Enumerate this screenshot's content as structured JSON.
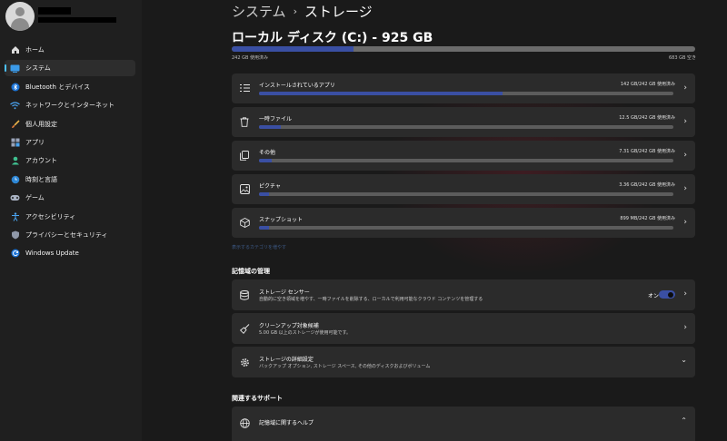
{
  "sidebar": {
    "items": [
      {
        "label": "ホーム",
        "icon": "home-icon"
      },
      {
        "label": "システム",
        "icon": "system-icon"
      },
      {
        "label": "Bluetooth とデバイス",
        "icon": "bluetooth-icon"
      },
      {
        "label": "ネットワークとインターネット",
        "icon": "wifi-icon"
      },
      {
        "label": "個人用設定",
        "icon": "brush-icon"
      },
      {
        "label": "アプリ",
        "icon": "apps-icon"
      },
      {
        "label": "アカウント",
        "icon": "account-icon"
      },
      {
        "label": "時刻と言語",
        "icon": "globe-clock-icon"
      },
      {
        "label": "ゲーム",
        "icon": "gamepad-icon"
      },
      {
        "label": "アクセシビリティ",
        "icon": "accessibility-icon"
      },
      {
        "label": "プライバシーとセキュリティ",
        "icon": "shield-icon"
      },
      {
        "label": "Windows Update",
        "icon": "update-icon"
      }
    ],
    "selected_index": 1
  },
  "header": {
    "parent": "システム",
    "separator": "›",
    "title": "ストレージ"
  },
  "drive": {
    "title": "ローカル ディスク (C:) - 925 GB",
    "used_text": "242 GB 使用済み",
    "free_text": "683 GB 空き",
    "used_fraction": 0.262
  },
  "categories": [
    {
      "label": "インストールされているアプリ",
      "value": "142 GB/242 GB 使用済み",
      "fraction": 0.587,
      "icon": "apps-list-icon"
    },
    {
      "label": "一時ファイル",
      "value": "12.5 GB/242 GB 使用済み",
      "fraction": 0.052,
      "icon": "trash-icon"
    },
    {
      "label": "その他",
      "value": "7.31 GB/242 GB 使用済み",
      "fraction": 0.03,
      "icon": "documents-icon"
    },
    {
      "label": "ピクチャ",
      "value": "3.36 GB/242 GB 使用済み",
      "fraction": 0.014,
      "icon": "picture-icon"
    },
    {
      "label": "スナップショット",
      "value": "899 MB/242 GB 使用済み",
      "fraction": 0.004,
      "icon": "snapshot-icon"
    }
  ],
  "more_categories_link": "表示するカテゴリを増やす",
  "management": {
    "section_title": "記憶域の管理",
    "storage_sense": {
      "label": "ストレージ センサー",
      "description": "自動的に空き領域を増やす、一時ファイルを削除する、ローカルで利用可能なクラウド コンテンツを管理する",
      "toggle_text": "オン",
      "toggle_on": true
    },
    "cleanup": {
      "label": "クリーンアップ対象候補",
      "description": "5.00 GB 以上のストレージが使用可能です。"
    },
    "advanced": {
      "label": "ストレージの詳細設定",
      "description": "バックアップ オプション, ストレージ スペース, その他のディスクおよびボリューム"
    }
  },
  "support": {
    "section_title": "関連するサポート",
    "help_label": "記憶域に関するヘルプ"
  },
  "colors": {
    "accent_bar": "#3a4fa3",
    "toggle_on": "#3a4fa3",
    "nav_indicator": "#4cc2ff",
    "card_bg": "#2b2b2b"
  }
}
